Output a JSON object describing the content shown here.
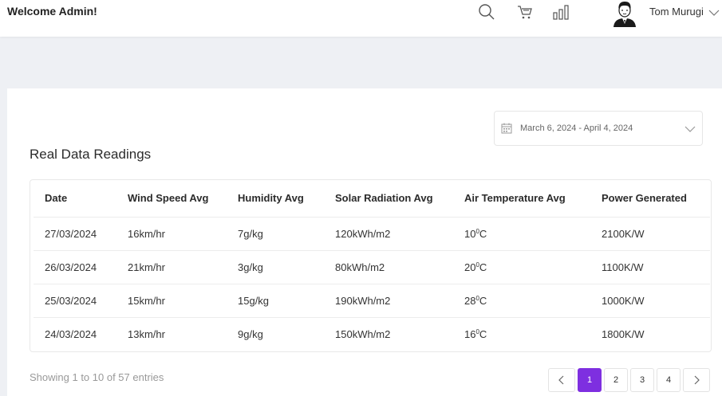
{
  "header": {
    "welcome": "Welcome Admin!",
    "user_name": "Tom Murugi",
    "icons": [
      "search-icon",
      "cart-icon",
      "chart-icon"
    ]
  },
  "card": {
    "date_range": "March 6, 2024 - April 4, 2024",
    "title": "Real Data Readings"
  },
  "table": {
    "columns": [
      "Date",
      "Wind Speed Avg",
      "Humidity Avg",
      "Solar Radiation Avg",
      "Air Temperature Avg",
      "Power Generated"
    ],
    "rows": [
      {
        "date": "27/03/2024",
        "wind": "16km/hr",
        "humidity": "7g/kg",
        "solar": "120kWh/m2",
        "temp": "10",
        "power": "2100K/W"
      },
      {
        "date": "26/03/2024",
        "wind": "21km/hr",
        "humidity": "3g/kg",
        "solar": "80kWh/m2",
        "temp": "20",
        "power": "1100K/W"
      },
      {
        "date": "25/03/2024",
        "wind": "15km/hr",
        "humidity": "15g/kg",
        "solar": "190kWh/m2",
        "temp": "28",
        "power": "1000K/W"
      },
      {
        "date": "24/03/2024",
        "wind": "13km/hr",
        "humidity": "9g/kg",
        "solar": "150kWh/m2",
        "temp": "16",
        "power": "1800K/W"
      }
    ],
    "temp_unit_sup": "0",
    "temp_unit": "C"
  },
  "footer": {
    "entries": "Showing 1 to 10 of 57 entries",
    "pages": [
      "1",
      "2",
      "3",
      "4"
    ],
    "active_page": "1",
    "prev": "‹",
    "next": "›"
  },
  "colors": {
    "accent": "#7e2fe0",
    "background": "#eef0f4"
  }
}
